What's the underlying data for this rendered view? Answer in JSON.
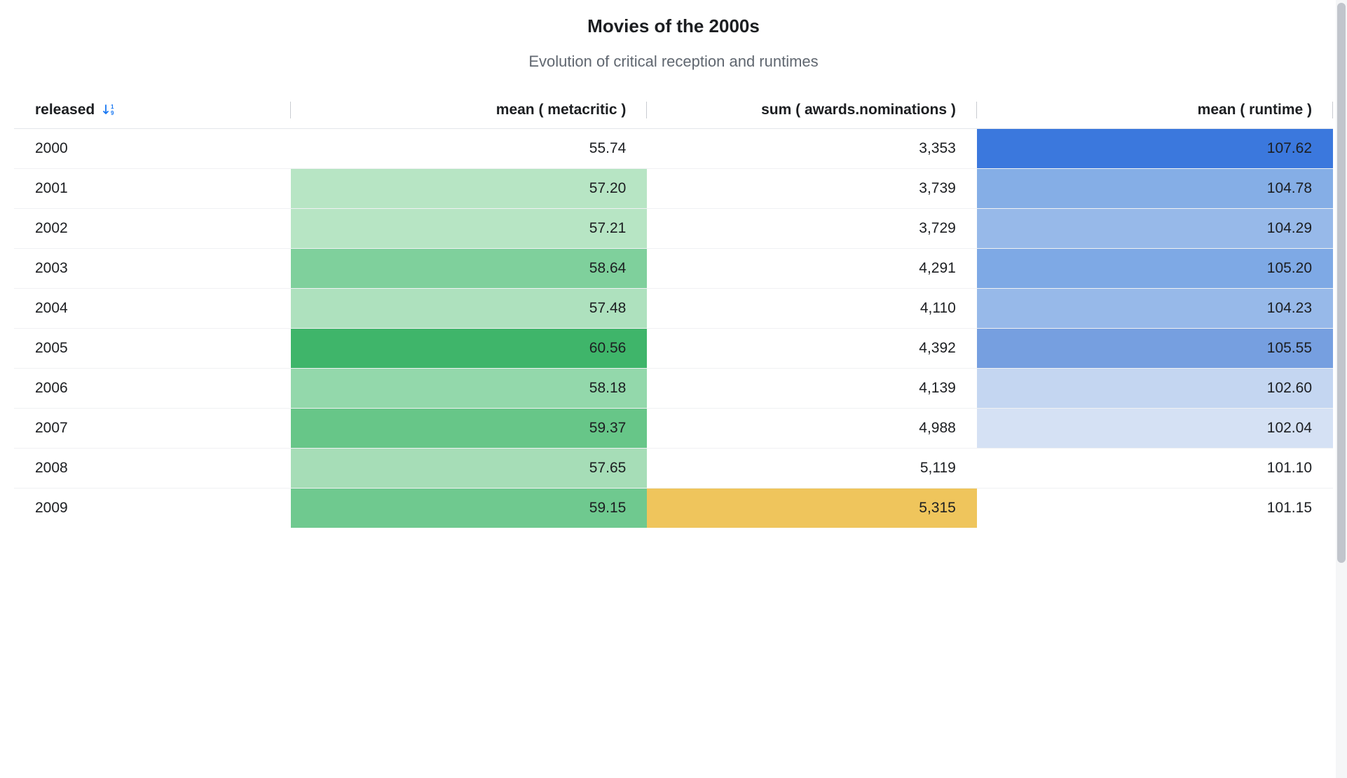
{
  "chart_data": {
    "type": "table",
    "title": "Movies of the 2000s",
    "subtitle": "Evolution of critical reception and runtimes",
    "columns": [
      {
        "key": "released",
        "label": "released",
        "sorted": "asc_numeric"
      },
      {
        "key": "mean_metacritic",
        "label": "mean ( metacritic )"
      },
      {
        "key": "sum_nominations",
        "label": "sum ( awards.nominations )"
      },
      {
        "key": "mean_runtime",
        "label": "mean ( runtime )"
      }
    ],
    "rows": [
      {
        "released": "2000",
        "mean_metacritic": "55.74",
        "sum_nominations": "3,353",
        "mean_runtime": "107.62",
        "bg_metacritic": "#ffffff",
        "bg_nominations": "#ffffff",
        "bg_runtime": "#3b78dd"
      },
      {
        "released": "2001",
        "mean_metacritic": "57.20",
        "sum_nominations": "3,739",
        "mean_runtime": "104.78",
        "bg_metacritic": "#b7e5c4",
        "bg_nominations": "#ffffff",
        "bg_runtime": "#85aee6"
      },
      {
        "released": "2002",
        "mean_metacritic": "57.21",
        "sum_nominations": "3,729",
        "mean_runtime": "104.29",
        "bg_metacritic": "#b7e5c4",
        "bg_nominations": "#ffffff",
        "bg_runtime": "#97b9e9"
      },
      {
        "released": "2003",
        "mean_metacritic": "58.64",
        "sum_nominations": "4,291",
        "mean_runtime": "105.20",
        "bg_metacritic": "#7fd09c",
        "bg_nominations": "#ffffff",
        "bg_runtime": "#7ea9e5"
      },
      {
        "released": "2004",
        "mean_metacritic": "57.48",
        "sum_nominations": "4,110",
        "mean_runtime": "104.23",
        "bg_metacritic": "#aee1be",
        "bg_nominations": "#ffffff",
        "bg_runtime": "#97b9e9"
      },
      {
        "released": "2005",
        "mean_metacritic": "60.56",
        "sum_nominations": "4,392",
        "mean_runtime": "105.55",
        "bg_metacritic": "#3fb56a",
        "bg_nominations": "#ffffff",
        "bg_runtime": "#769fe0"
      },
      {
        "released": "2006",
        "mean_metacritic": "58.18",
        "sum_nominations": "4,139",
        "mean_runtime": "102.60",
        "bg_metacritic": "#93d8ab",
        "bg_nominations": "#ffffff",
        "bg_runtime": "#c4d6f1"
      },
      {
        "released": "2007",
        "mean_metacritic": "59.37",
        "sum_nominations": "4,988",
        "mean_runtime": "102.04",
        "bg_metacritic": "#67c688",
        "bg_nominations": "#ffffff",
        "bg_runtime": "#d5e1f4"
      },
      {
        "released": "2008",
        "mean_metacritic": "57.65",
        "sum_nominations": "5,119",
        "mean_runtime": "101.10",
        "bg_metacritic": "#a6ddb7",
        "bg_nominations": "#ffffff",
        "bg_runtime": "#ffffff"
      },
      {
        "released": "2009",
        "mean_metacritic": "59.15",
        "sum_nominations": "5,315",
        "mean_runtime": "101.15",
        "bg_metacritic": "#6fc98f",
        "bg_nominations": "#efc55c",
        "bg_runtime": "#ffffff"
      }
    ]
  }
}
